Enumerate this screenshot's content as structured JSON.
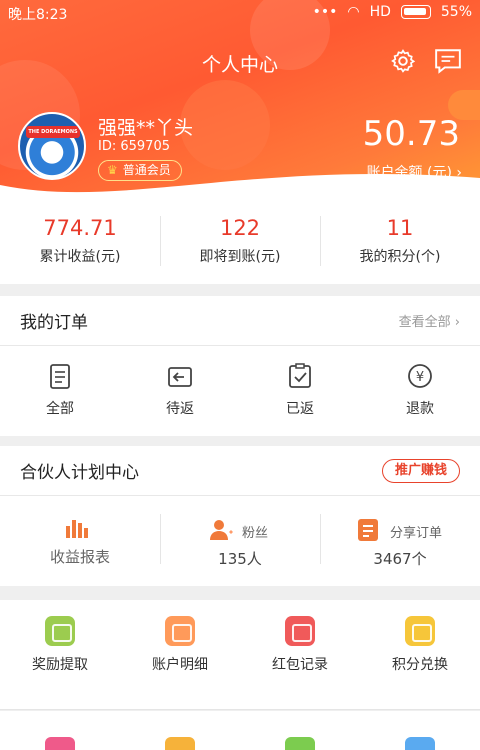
{
  "status_bar": {
    "time": "晚上8:23",
    "network": "HD",
    "battery": "55%"
  },
  "header": {
    "title": "个人中心",
    "username": "强强**丫头",
    "user_id": "ID: 659705",
    "member_badge": "普通会员",
    "avatar_banner": "THE DORAEMONS",
    "balance": "50.73",
    "balance_label": "账户余额 (元) ›"
  },
  "stats": [
    {
      "value": "774.71",
      "label": "累计收益(元)"
    },
    {
      "value": "122",
      "label": "即将到账(元)"
    },
    {
      "value": "11",
      "label": "我的积分(个)"
    }
  ],
  "orders": {
    "title": "我的订单",
    "view_all": "查看全部 ›",
    "items": [
      {
        "label": "全部",
        "icon": "clipboard-list-icon"
      },
      {
        "label": "待返",
        "icon": "return-arrow-icon"
      },
      {
        "label": "已返",
        "icon": "clipboard-check-icon"
      },
      {
        "label": "退款",
        "icon": "refund-yuan-icon"
      }
    ]
  },
  "partner": {
    "title": "合伙人计划中心",
    "promo_button": "推广赚钱",
    "report_label": "收益报表",
    "fans_label": "粉丝",
    "fans_value": "135人",
    "shared_orders_label": "分享订单",
    "shared_orders_value": "3467个"
  },
  "services": [
    {
      "label": "奖励提取",
      "color": "#9ccc4f",
      "icon": "wallet-icon"
    },
    {
      "label": "账户明细",
      "color": "#ff9a5a",
      "icon": "ledger-icon"
    },
    {
      "label": "红包记录",
      "color": "#f05a5a",
      "icon": "red-envelope-icon"
    },
    {
      "label": "积分兑换",
      "color": "#f6c63a",
      "icon": "coins-icon"
    }
  ],
  "colors": {
    "accent": "#e83a2a",
    "header_start": "#ff5a32",
    "header_end": "#ffa033"
  }
}
